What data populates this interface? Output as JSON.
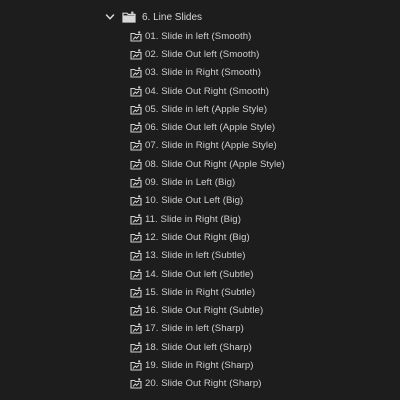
{
  "folder": {
    "label": "6. Line Slides",
    "expanded": true,
    "icon": "folder-icon"
  },
  "items": [
    {
      "label": "01. Slide in left (Smooth)",
      "icon": "sequence-icon"
    },
    {
      "label": "02. Slide Out left (Smooth)",
      "icon": "sequence-icon"
    },
    {
      "label": "03. Slide in Right (Smooth)",
      "icon": "sequence-icon"
    },
    {
      "label": "04. Slide Out Right (Smooth)",
      "icon": "sequence-icon"
    },
    {
      "label": "05. Slide in left (Apple Style)",
      "icon": "sequence-icon"
    },
    {
      "label": "06. Slide Out left (Apple Style)",
      "icon": "sequence-icon"
    },
    {
      "label": "07. Slide in Right (Apple Style)",
      "icon": "sequence-icon"
    },
    {
      "label": "08. Slide Out Right (Apple Style)",
      "icon": "sequence-icon"
    },
    {
      "label": "09. Slide in Left (Big)",
      "icon": "sequence-icon"
    },
    {
      "label": "10. Slide Out Left (Big)",
      "icon": "sequence-icon"
    },
    {
      "label": "11. Slide in Right (Big)",
      "icon": "sequence-icon"
    },
    {
      "label": "12. Slide Out Right (Big)",
      "icon": "sequence-icon"
    },
    {
      "label": "13. Slide in left (Subtle)",
      "icon": "sequence-icon"
    },
    {
      "label": "14. Slide Out left (Subtle)",
      "icon": "sequence-icon"
    },
    {
      "label": "15. Slide in Right (Subtle)",
      "icon": "sequence-icon"
    },
    {
      "label": "16. Slide Out Right (Subtle)",
      "icon": "sequence-icon"
    },
    {
      "label": "17. Slide in left (Sharp)",
      "icon": "sequence-icon"
    },
    {
      "label": "18. Slide Out left (Sharp)",
      "icon": "sequence-icon"
    },
    {
      "label": "19. Slide in Right (Sharp)",
      "icon": "sequence-icon"
    },
    {
      "label": "20. Slide Out Right (Sharp)",
      "icon": "sequence-icon"
    }
  ]
}
